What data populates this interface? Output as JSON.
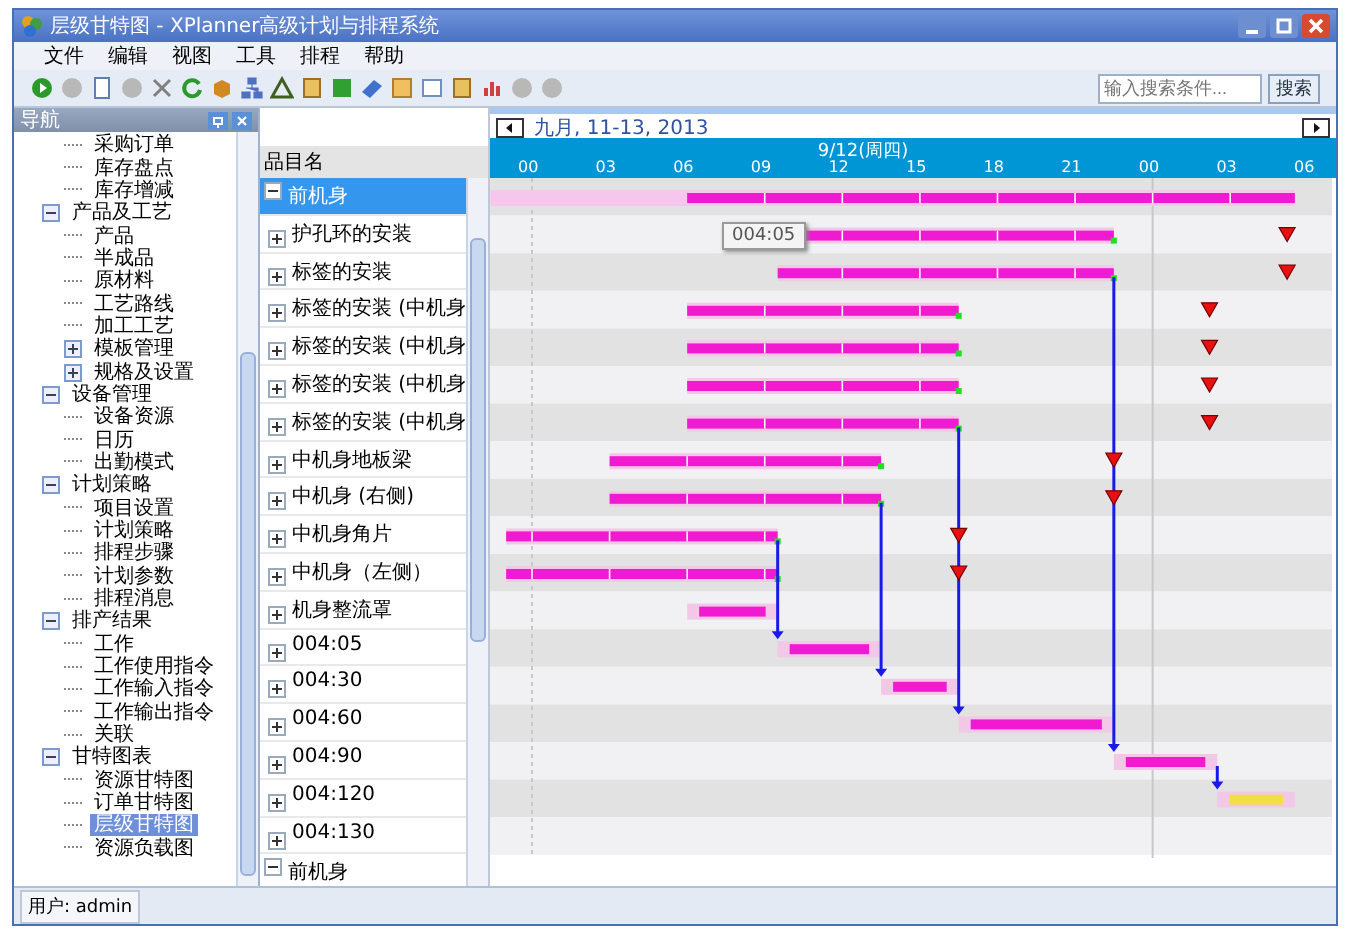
{
  "window": {
    "title": "层级甘特图 - XPlanner高级计划与排程系统"
  },
  "menu": [
    "文件",
    "编辑",
    "视图",
    "工具",
    "排程",
    "帮助"
  ],
  "search": {
    "placeholder": "输入搜索条件...",
    "button": "搜索"
  },
  "nav": {
    "title": "导航",
    "groups": [
      {
        "children": [
          {
            "label": "采购订单",
            "selected": false
          },
          {
            "label": "库存盘点",
            "selected": false
          },
          {
            "label": "库存增减",
            "selected": false
          }
        ]
      },
      {
        "label": "产品及工艺",
        "expanded": true,
        "children": [
          {
            "label": "产品",
            "selected": false
          },
          {
            "label": "半成品",
            "selected": false
          },
          {
            "label": "原材料",
            "selected": false
          },
          {
            "label": "工艺路线",
            "selected": false
          },
          {
            "label": "加工工艺",
            "selected": false
          },
          {
            "label": "模板管理",
            "selected": false,
            "expanded": false
          },
          {
            "label": "规格及设置",
            "selected": false,
            "expanded": false
          }
        ]
      },
      {
        "label": "设备管理",
        "expanded": true,
        "children": [
          {
            "label": "设备资源",
            "selected": false
          },
          {
            "label": "日历",
            "selected": false
          },
          {
            "label": "出勤模式",
            "selected": false
          }
        ]
      },
      {
        "label": "计划策略",
        "expanded": true,
        "children": [
          {
            "label": "项目设置",
            "selected": false
          },
          {
            "label": "计划策略",
            "selected": false
          },
          {
            "label": "排程步骤",
            "selected": false
          },
          {
            "label": "计划参数",
            "selected": false
          },
          {
            "label": "排程消息",
            "selected": false
          }
        ]
      },
      {
        "label": "排产结果",
        "expanded": true,
        "children": [
          {
            "label": "工作",
            "selected": false
          },
          {
            "label": "工作使用指令",
            "selected": false
          },
          {
            "label": "工作输入指令",
            "selected": false
          },
          {
            "label": "工作输出指令",
            "selected": false
          },
          {
            "label": "关联",
            "selected": false
          }
        ]
      },
      {
        "label": "甘特图表",
        "expanded": true,
        "children": [
          {
            "label": "资源甘特图",
            "selected": false
          },
          {
            "label": "订单甘特图",
            "selected": false
          },
          {
            "label": "层级甘特图",
            "selected": true
          },
          {
            "label": "资源负载图",
            "selected": false
          }
        ]
      }
    ]
  },
  "items": {
    "header": "品目名",
    "rows": [
      {
        "label": "前机身",
        "expanded": true,
        "selected": true,
        "children": [
          {
            "label": "护孔环的安装",
            "expanded": false,
            "selected": false
          },
          {
            "label": "标签的安装",
            "expanded": false,
            "selected": false
          },
          {
            "label": "标签的安装 (中机身",
            "expanded": false,
            "selected": false
          },
          {
            "label": "标签的安装 (中机身",
            "expanded": false,
            "selected": false
          },
          {
            "label": "标签的安装 (中机身",
            "expanded": false,
            "selected": false
          },
          {
            "label": "标签的安装 (中机身",
            "expanded": false,
            "selected": false
          },
          {
            "label": "中机身地板梁",
            "expanded": false,
            "selected": false
          },
          {
            "label": "中机身 (右侧)",
            "expanded": false,
            "selected": false
          },
          {
            "label": "中机身角片",
            "expanded": false,
            "selected": false
          },
          {
            "label": "中机身（左侧）",
            "expanded": false,
            "selected": false
          },
          {
            "label": "机身整流罩",
            "expanded": false,
            "selected": false
          },
          {
            "label": "004:05",
            "expanded": false,
            "selected": false
          },
          {
            "label": "004:30",
            "expanded": false,
            "selected": false
          },
          {
            "label": "004:60",
            "expanded": false,
            "selected": false
          },
          {
            "label": "004:90",
            "expanded": false,
            "selected": false
          },
          {
            "label": "004:120",
            "expanded": false,
            "selected": false
          },
          {
            "label": "004:130",
            "expanded": false,
            "selected": false
          }
        ]
      },
      {
        "label": "前机身",
        "expanded": true,
        "selected": false
      }
    ]
  },
  "gantt": {
    "range": "九月, 11-13, 2013",
    "day": "9/12(周四)",
    "hours": [
      "00",
      "03",
      "06",
      "09",
      "12",
      "15",
      "18",
      "21",
      "00",
      "03",
      "06"
    ],
    "tooltip": "004:05"
  },
  "status_bar": "用户: admin"
}
